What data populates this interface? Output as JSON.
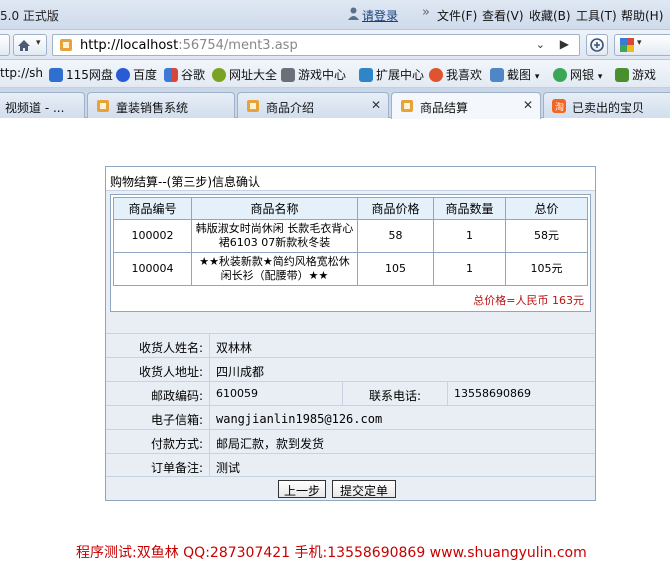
{
  "browser": {
    "title_fragment": "5.0 正式版",
    "login": "请登录",
    "menus": [
      "文件(F)",
      "查看(V)",
      "收藏(B)",
      "工具(T)",
      "帮助(H)"
    ],
    "url_host": "http://localhost",
    "url_rest": ":56754/ment3.asp",
    "favorites": [
      "ttp://sh",
      "115网盘",
      "百度",
      "谷歌",
      "网址大全",
      "游戏中心",
      "扩展中心",
      "我喜欢",
      "截图",
      "网银",
      "游戏"
    ],
    "tabs": [
      {
        "label": "视频道 - ...",
        "active": false
      },
      {
        "label": "童装销售系统",
        "active": false
      },
      {
        "label": "商品介绍",
        "active": false
      },
      {
        "label": "商品结算",
        "active": true
      },
      {
        "label": "已卖出的宝贝",
        "active": false
      }
    ]
  },
  "checkout": {
    "title": "购物结算--(第三步)信息确认",
    "headers": [
      "商品编号",
      "商品名称",
      "商品价格",
      "商品数量",
      "总价"
    ],
    "rows": [
      {
        "id": "100002",
        "name": "韩版淑女时尚休闲 长款毛衣背心裙6103 07新款秋冬装",
        "price": "58",
        "qty": "1",
        "total": "58元"
      },
      {
        "id": "100004",
        "name": "★★秋装新款★简约风格宽松休闲长衫（配腰带）★★",
        "price": "105",
        "qty": "1",
        "total": "105元"
      }
    ],
    "grand_total": "总价格=人民币  163元",
    "fields": {
      "name_label": "收货人姓名:",
      "name_value": "双林林",
      "address_label": "收货人地址:",
      "address_value": "四川成都",
      "zip_label": "邮政编码:",
      "zip_value": "610059",
      "phone_label": "联系电话:",
      "phone_value": "13558690869",
      "email_label": "电子信箱:",
      "email_value": "wangjianlin1985@126.com",
      "payment_label": "付款方式:",
      "payment_value": "邮局汇款，款到发货",
      "note_label": "订单备注:",
      "note_value": "测试"
    },
    "prev_button": "上一步",
    "submit_button": "提交定单"
  },
  "footer": "程序测试:双鱼林 QQ:287307421 手机:13558690869 www.shuangyulin.com"
}
